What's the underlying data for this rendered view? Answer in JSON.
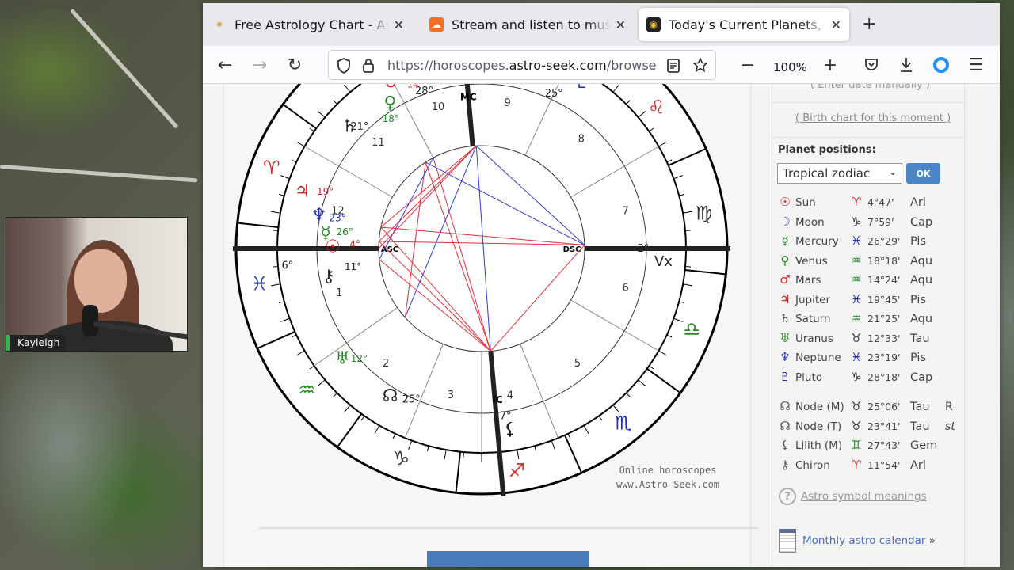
{
  "browser": {
    "tabs": [
      {
        "title": "Free Astrology Chart - Astro"
      },
      {
        "title": "Stream and listen to music"
      },
      {
        "title": "Today's Current Planets, As"
      }
    ],
    "url_prefix": "https://horoscopes.",
    "url_domain": "astro-seek.com",
    "url_suffix": "/browse",
    "zoom": "100%"
  },
  "webcam": {
    "name": "Kayleigh"
  },
  "chart": {
    "watermark_line1": "Online horoscopes",
    "watermark_line2": "www.Astro-Seek.com",
    "angles": {
      "asc": "ASC",
      "dsc": "DSC",
      "mc": "MC",
      "ic": "IC"
    },
    "house_numbers": [
      "1",
      "2",
      "3",
      "4",
      "5",
      "6",
      "7",
      "8",
      "9",
      "10",
      "11",
      "12"
    ],
    "cusp_degrees": [
      "6°",
      "2°",
      "9°",
      "27°",
      "25°",
      "28°",
      "21°",
      "25°"
    ],
    "planet_degrees": [
      "14°",
      "18°",
      "19°",
      "23°",
      "26°",
      "4°",
      "11°",
      "12°"
    ],
    "vertex_label": "Vx"
  },
  "sidebar": {
    "enter_date": "( Enter date manually )",
    "birth_chart": "( Birth chart for this moment )",
    "positions_title": "Planet positions:",
    "zodiac_select": "Tropical zodiac",
    "ok": "OK",
    "planets": [
      {
        "glyph": "☉",
        "name": "Sun",
        "zglyph": "♈",
        "deg": "4°47'",
        "sign": "Ari",
        "extra": ""
      },
      {
        "glyph": "☽",
        "name": "Moon",
        "zglyph": "♑",
        "deg": "7°59'",
        "sign": "Cap",
        "extra": ""
      },
      {
        "glyph": "☿",
        "name": "Mercury",
        "zglyph": "♓",
        "deg": "26°29'",
        "sign": "Pis",
        "extra": ""
      },
      {
        "glyph": "♀",
        "name": "Venus",
        "zglyph": "♒",
        "deg": "18°18'",
        "sign": "Aqu",
        "extra": ""
      },
      {
        "glyph": "♂",
        "name": "Mars",
        "zglyph": "♒",
        "deg": "14°24'",
        "sign": "Aqu",
        "extra": ""
      },
      {
        "glyph": "♃",
        "name": "Jupiter",
        "zglyph": "♓",
        "deg": "19°45'",
        "sign": "Pis",
        "extra": ""
      },
      {
        "glyph": "♄",
        "name": "Saturn",
        "zglyph": "♒",
        "deg": "21°25'",
        "sign": "Aqu",
        "extra": ""
      },
      {
        "glyph": "♅",
        "name": "Uranus",
        "zglyph": "♉",
        "deg": "12°33'",
        "sign": "Tau",
        "extra": ""
      },
      {
        "glyph": "♆",
        "name": "Neptune",
        "zglyph": "♓",
        "deg": "23°19'",
        "sign": "Pis",
        "extra": ""
      },
      {
        "glyph": "♇",
        "name": "Pluto",
        "zglyph": "♑",
        "deg": "28°18'",
        "sign": "Cap",
        "extra": ""
      }
    ],
    "points": [
      {
        "glyph": "☊",
        "name": "Node (M)",
        "zglyph": "♉",
        "deg": "25°06'",
        "sign": "Tau",
        "extra": "R"
      },
      {
        "glyph": "☊",
        "name": "Node (T)",
        "zglyph": "♉",
        "deg": "23°41'",
        "sign": "Tau",
        "extra": "st"
      },
      {
        "glyph": "⚸",
        "name": "Lilith (M)",
        "zglyph": "♊",
        "deg": "27°43'",
        "sign": "Gem",
        "extra": ""
      },
      {
        "glyph": "⚷",
        "name": "Chiron",
        "zglyph": "♈",
        "deg": "11°54'",
        "sign": "Ari",
        "extra": ""
      }
    ],
    "symbol_meanings": "Astro symbol meanings",
    "monthly_calendar": "Monthly astro calendar",
    "calendar_suffix": "»"
  },
  "colors": {
    "link": "#4d6db5",
    "ok_button": "#4d86c6",
    "red_aspect": "#e0303a",
    "blue_aspect": "#2f3fd0",
    "fire": "#d03030",
    "earth": "#303030",
    "air": "#2a8a2a",
    "water": "#2030b0"
  },
  "icons": {
    "back": "back-arrow-icon",
    "forward": "forward-arrow-icon",
    "reload": "reload-icon",
    "shield": "shield-icon",
    "lock": "lock-icon",
    "reader": "reader-view-icon",
    "bookmark": "star-icon",
    "pocket": "pocket-icon",
    "download": "download-icon",
    "menu": "hamburger-menu-icon"
  }
}
